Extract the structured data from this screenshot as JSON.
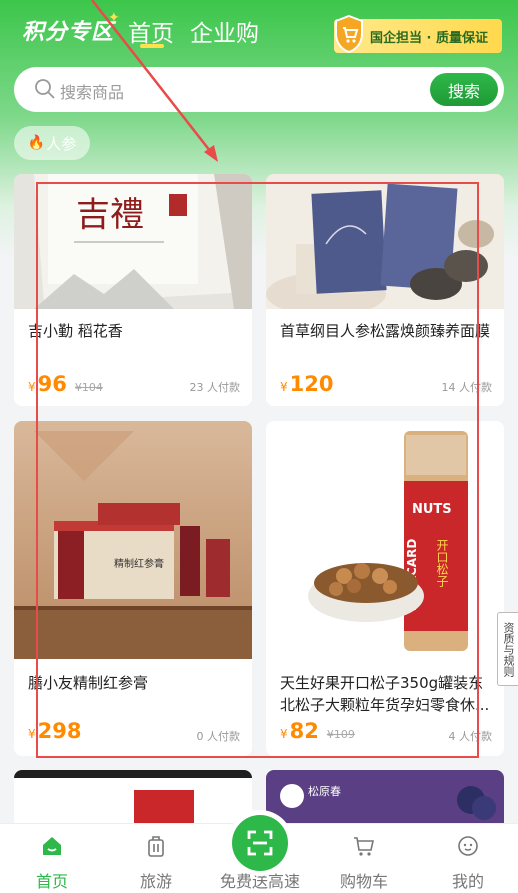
{
  "header": {
    "logo": "积分专区",
    "tabs": [
      "首页",
      "企业购"
    ],
    "guarantee": "国企担当 · 质量保证"
  },
  "search": {
    "placeholder": "搜索商品",
    "button": "搜索"
  },
  "category_chip": "人参",
  "products": [
    {
      "name": "吉小勤 稻花香",
      "currency": "¥",
      "price": "96",
      "original": "¥104",
      "paid": "23 人付款"
    },
    {
      "name": "首草纲目人参松露焕颜臻养面膜",
      "currency": "¥",
      "price": "120",
      "original": "",
      "paid": "14 人付款"
    },
    {
      "name": "膳小友精制红参膏",
      "currency": "¥",
      "price": "298",
      "original": "",
      "paid": "0 人付款"
    },
    {
      "name": "天生好果开口松子350g罐装东北松子大颗粒年货孕妇零食休...",
      "currency": "¥",
      "price": "82",
      "original": "¥109",
      "paid": "4 人付款"
    }
  ],
  "image_text": {
    "p1_brand": "吉禮",
    "p3_box": "精制红参膏",
    "p4_brand": "NUTS",
    "p4_card": "MIKACARD",
    "p4_cn": "开口松子",
    "p6_brand": "松原春"
  },
  "side_tab": "资质与规则",
  "bottom_nav": [
    "首页",
    "旅游",
    "免费送高速",
    "购物车",
    "我的"
  ],
  "colors": {
    "brand_green": "#2fb84a",
    "price_orange": "#ff8a00",
    "annotation_red": "#e94a4a"
  }
}
